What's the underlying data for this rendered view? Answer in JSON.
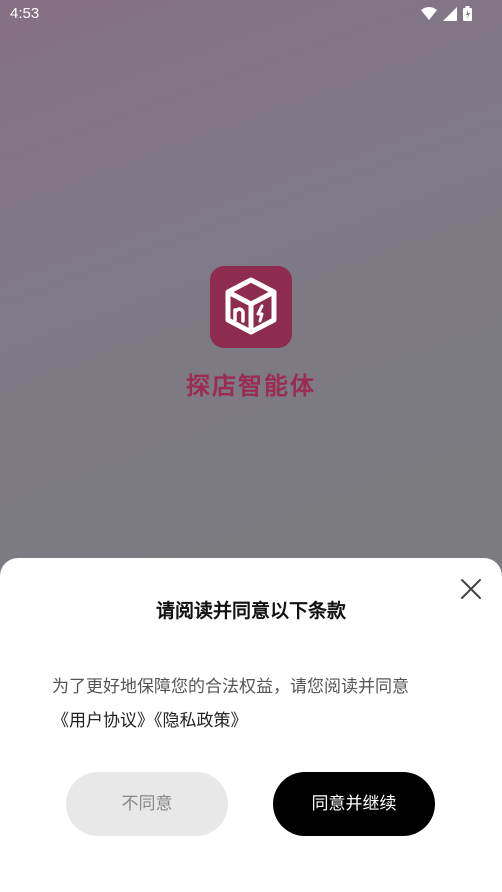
{
  "status": {
    "time": "4:53"
  },
  "app": {
    "name": "探店智能体",
    "brand_color": "#9a2c52"
  },
  "dialog": {
    "title": "请阅读并同意以下条款",
    "message": "为了更好地保障您的合法权益，请您阅读并同意",
    "user_agreement": "《用户协议》",
    "privacy_policy": "《隐私政策》",
    "disagree_label": "不同意",
    "agree_label": "同意并继续"
  }
}
